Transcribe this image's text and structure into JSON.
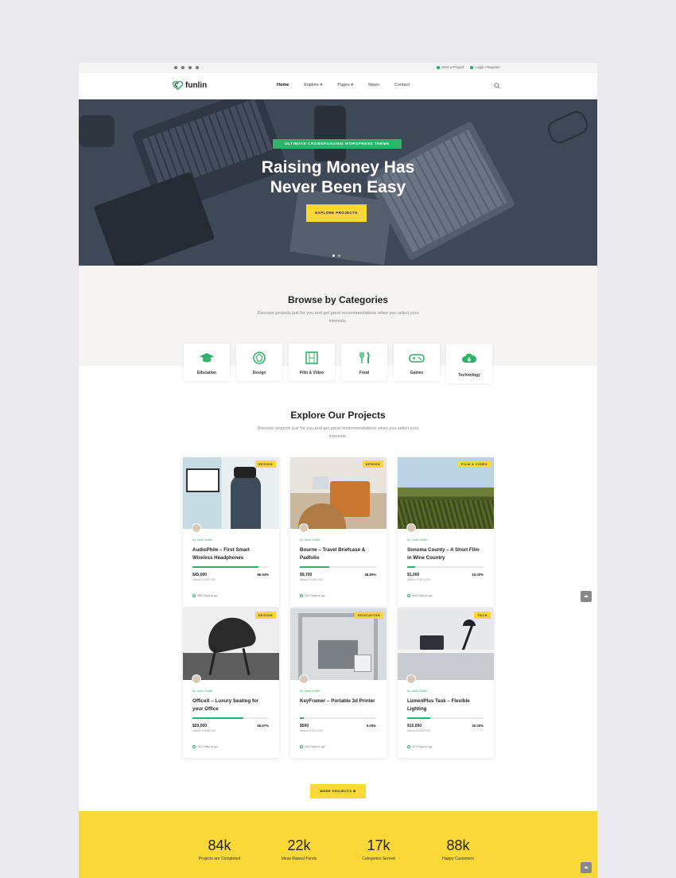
{
  "topbar": {
    "social": [
      "facebook-icon",
      "twitter-icon",
      "instagram-icon",
      "pinterest-icon"
    ],
    "start_project": "Start a Project",
    "login_register": "Login / Register"
  },
  "header": {
    "logo": "funlin",
    "nav": [
      "Home",
      "Explore",
      "Pages",
      "News",
      "Contact"
    ]
  },
  "hero": {
    "ribbon": "Ultimate Crowdfunding WordPress Theme",
    "title_line1": "Raising Money Has",
    "title_line2": "Never Been Easy",
    "button": "Explore Projects"
  },
  "categories": {
    "title": "Browse by Categories",
    "subtitle": "Discover projects just for you and get great recommendations when you select your interests.",
    "items": [
      {
        "label": "Education",
        "icon": "graduation-cap-icon"
      },
      {
        "label": "Design",
        "icon": "design-icon"
      },
      {
        "label": "Film & Video",
        "icon": "film-icon"
      },
      {
        "label": "Food",
        "icon": "fork-knife-icon"
      },
      {
        "label": "Games",
        "icon": "gamepad-icon"
      },
      {
        "label": "Technology",
        "icon": "cloud-download-icon"
      }
    ]
  },
  "projects": {
    "title": "Explore Our Projects",
    "subtitle": "Discover projects just for you and get great recommendations when you select your interests.",
    "more_button": "More Projects",
    "cards": [
      {
        "tag": "Design",
        "author": "by Jane Smith",
        "title": "AudioPhile – First Smart Wireless Headphones",
        "amount": "$45,000",
        "raised": "raised of $52,000",
        "percent": "86.54%",
        "progress": 0.8654,
        "days": "380 Days to go"
      },
      {
        "tag": "Design",
        "author": "by Jane Smith",
        "title": "Bourne – Travel Briefcase & Padfolio",
        "amount": "$9,700",
        "raised": "raised of $25,000",
        "percent": "38.80%",
        "progress": 0.388,
        "days": "101 Days to go"
      },
      {
        "tag": "Film & Video",
        "author": "by Jane Smith",
        "title": "Sonoma County – A Short Film in Wine Country",
        "amount": "$1,000",
        "raised": "raised of $10,000",
        "percent": "10.00%",
        "progress": 0.1,
        "days": "466 Days to go"
      },
      {
        "tag": "Design",
        "author": "by Jane Smith",
        "title": "OfficeX – Luxury Seating for your Office",
        "amount": "$20,000",
        "raised": "raised of $30,000",
        "percent": "66.67%",
        "progress": 0.6667,
        "days": "101 Days to go"
      },
      {
        "tag": "Education",
        "author": "by Jane Smith",
        "title": "KeyFramer – Portable 3d Printer",
        "amount": "$500",
        "raised": "raised of $10,000",
        "percent": "5.00%",
        "progress": 0.05,
        "days": "101 Days to go"
      },
      {
        "tag": "Tech",
        "author": "by Jane Smith",
        "title": "LumenPlus Task – Flexible Lighting",
        "amount": "$15,000",
        "raised": "raised of $50,000",
        "percent": "30.00%",
        "progress": 0.3,
        "days": "101 Days to go"
      }
    ]
  },
  "stats": [
    {
      "num": "84k",
      "label": "Projects are Completed"
    },
    {
      "num": "22k",
      "label": "Ideas Raised Funds"
    },
    {
      "num": "17k",
      "label": "Categories Served"
    },
    {
      "num": "88k",
      "label": "Happy Customers"
    }
  ],
  "colors": {
    "accent": "#2fb36a",
    "yellow": "#f9d838",
    "hero_bg": "#3f4857"
  }
}
